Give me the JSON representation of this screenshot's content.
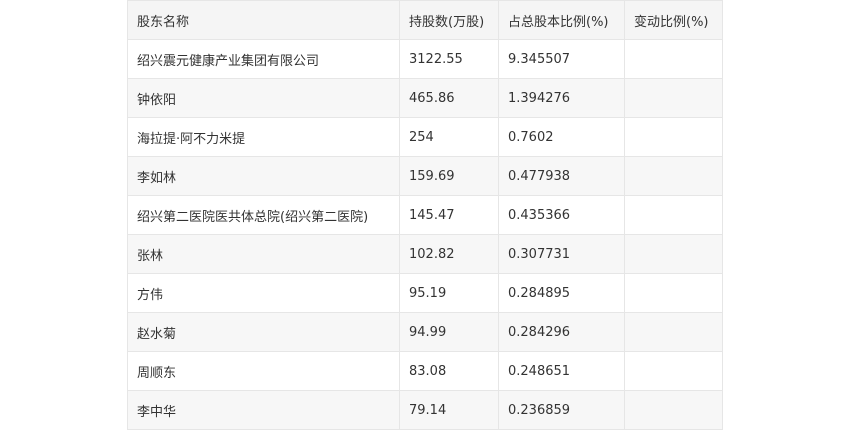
{
  "table": {
    "headers": [
      "股东名称",
      "持股数(万股)",
      "占总股本比例(%)",
      "变动比例(%)"
    ],
    "rows": [
      [
        "绍兴震元健康产业集团有限公司",
        "3122.55",
        "9.345507",
        ""
      ],
      [
        "钟依阳",
        "465.86",
        "1.394276",
        ""
      ],
      [
        "海拉提·阿不力米提",
        "254",
        "0.7602",
        ""
      ],
      [
        "李如林",
        "159.69",
        "0.477938",
        ""
      ],
      [
        "绍兴第二医院医共体总院(绍兴第二医院)",
        "145.47",
        "0.435366",
        ""
      ],
      [
        "张林",
        "102.82",
        "0.307731",
        ""
      ],
      [
        "方伟",
        "95.19",
        "0.284895",
        ""
      ],
      [
        "赵水菊",
        "94.99",
        "0.284296",
        ""
      ],
      [
        "周顺东",
        "83.08",
        "0.248651",
        ""
      ],
      [
        "李中华",
        "79.14",
        "0.236859",
        ""
      ]
    ]
  }
}
